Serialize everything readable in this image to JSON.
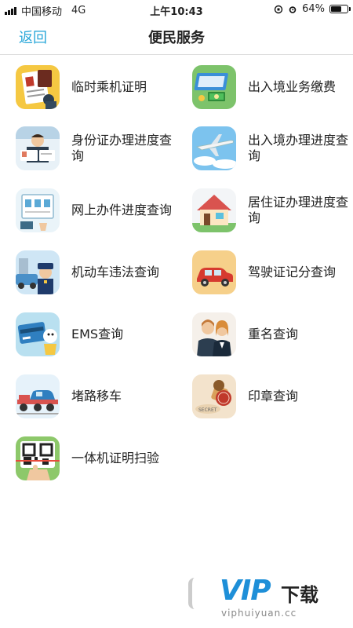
{
  "status_bar": {
    "carrier": "中国移动",
    "network": "4G",
    "time": "上午10:43",
    "battery": "64%",
    "battery_level": 0.64
  },
  "nav": {
    "back_label": "返回",
    "title": "便民服务"
  },
  "services": [
    {
      "label": "临时乘机证明",
      "icon": "certificate-icon"
    },
    {
      "label": "出入境业务缴费",
      "icon": "payment-icon"
    },
    {
      "label": "身份证办理进度查询",
      "icon": "id-card-icon"
    },
    {
      "label": "出入境办理进度查询",
      "icon": "airplane-icon"
    },
    {
      "label": "网上办件进度查询",
      "icon": "online-form-icon"
    },
    {
      "label": "居住证办理进度查询",
      "icon": "house-icon"
    },
    {
      "label": "机动车违法查询",
      "icon": "traffic-police-icon"
    },
    {
      "label": "驾驶证记分查询",
      "icon": "car-icon"
    },
    {
      "label": "EMS查询",
      "icon": "ems-card-icon"
    },
    {
      "label": "重名查询",
      "icon": "people-icon"
    },
    {
      "label": "堵路移车",
      "icon": "tow-truck-icon"
    },
    {
      "label": "印章查询",
      "icon": "stamp-icon"
    },
    {
      "label": "一体机证明扫验",
      "icon": "qr-scan-icon"
    }
  ],
  "watermark": {
    "logo_text": "VIP",
    "logo_cn": "下载",
    "url": "viphuiyuan.cc"
  }
}
